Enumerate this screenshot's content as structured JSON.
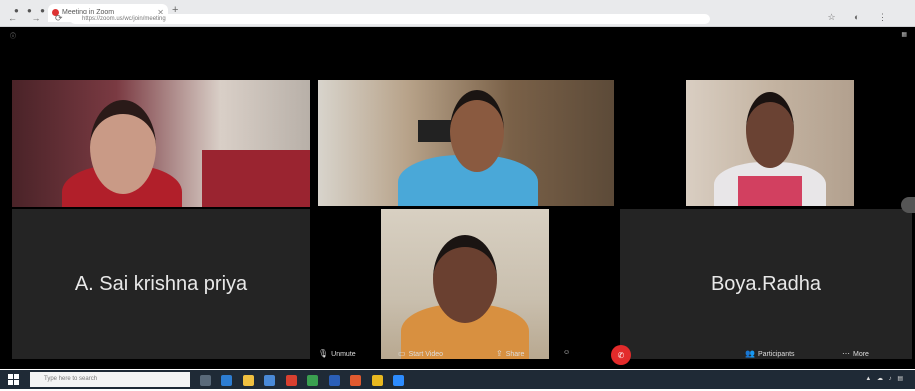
{
  "browser": {
    "tab_title": "Meeting in Zoom",
    "address": "https://zoom.us/wc/join/meeting"
  },
  "meeting": {
    "participants": [
      {
        "type": "video",
        "name": "",
        "colors": {
          "bg": "#6b3a3a",
          "skin": "#c99a86",
          "body": "#b11f2a"
        }
      },
      {
        "type": "video",
        "name": "",
        "colors": {
          "bg": "#8a7560",
          "skin": "#8a5a40",
          "body": "#4aa8d8"
        }
      },
      {
        "type": "video",
        "name": "",
        "colors": {
          "bg": "#c9b9a8",
          "skin": "#6a4233",
          "body": "#e8e6e8"
        }
      },
      {
        "type": "name",
        "name": "A. Sai krishna priya"
      },
      {
        "type": "video",
        "name": "",
        "colors": {
          "bg": "#c8c0b0",
          "skin": "#6a4030",
          "body": "#d89040"
        }
      },
      {
        "type": "name",
        "name": "Boya.Radha"
      }
    ],
    "controls": {
      "unmute": "Unmute",
      "start_video": "Start Video",
      "share": "Share",
      "participants": "Participants",
      "more": "More"
    }
  },
  "taskbar": {
    "search_placeholder": "Type here to search"
  }
}
